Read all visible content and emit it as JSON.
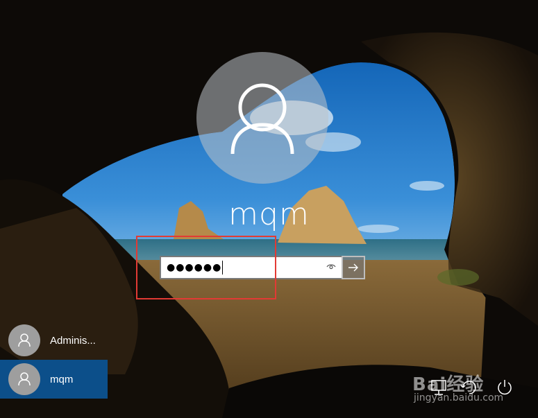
{
  "login": {
    "username": "mqm",
    "password_masked": "●●●●●●",
    "reveal_icon": "eye-icon",
    "submit_icon": "arrow-right-icon"
  },
  "users": [
    {
      "name": "Adminis...",
      "selected": false,
      "icon": "user-icon"
    },
    {
      "name": "mqm",
      "selected": true,
      "icon": "user-icon"
    }
  ],
  "system_icons": [
    "network-icon",
    "ease-of-access-icon",
    "power-icon"
  ],
  "watermark": {
    "brand": "Bai经验",
    "url": "jingyan.baidu.com"
  },
  "colors": {
    "highlight_border": "#e23a34",
    "selected_user_bg": "#0c4f8a"
  }
}
